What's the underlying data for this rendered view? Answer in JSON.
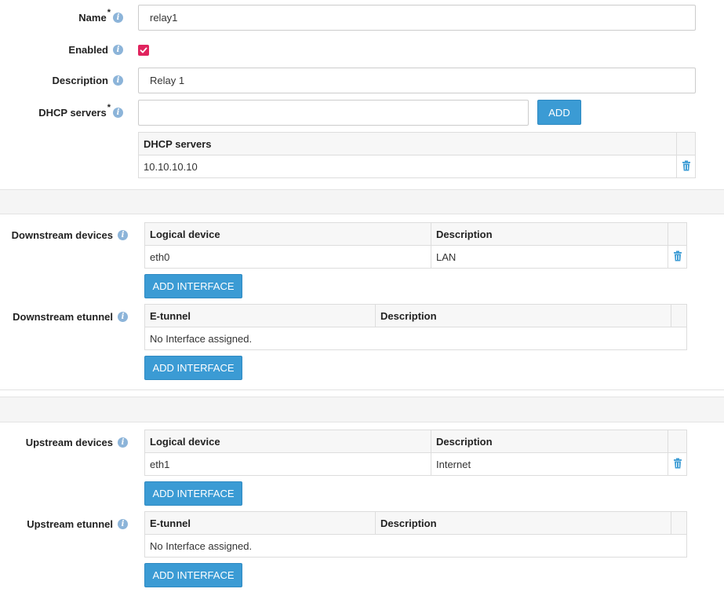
{
  "form": {
    "name": {
      "label": "Name",
      "required": "*",
      "value": "relay1"
    },
    "enabled": {
      "label": "Enabled",
      "checked": true
    },
    "description": {
      "label": "Description",
      "value": "Relay 1"
    },
    "dhcp_servers": {
      "label": "DHCP servers",
      "required": "*",
      "input_value": "",
      "add_label": "ADD",
      "table_header": "DHCP servers",
      "rows": [
        "10.10.10.10"
      ]
    }
  },
  "downstream": {
    "devices": {
      "label": "Downstream devices",
      "headers": [
        "Logical device",
        "Description"
      ],
      "rows": [
        {
          "device": "eth0",
          "description": "LAN"
        }
      ],
      "add_label": "ADD INTERFACE"
    },
    "etunnel": {
      "label": "Downstream etunnel",
      "headers": [
        "E-tunnel",
        "Description"
      ],
      "empty_text": "No Interface assigned.",
      "add_label": "ADD INTERFACE"
    }
  },
  "upstream": {
    "devices": {
      "label": "Upstream devices",
      "headers": [
        "Logical device",
        "Description"
      ],
      "rows": [
        {
          "device": "eth1",
          "description": "Internet"
        }
      ],
      "add_label": "ADD INTERFACE"
    },
    "etunnel": {
      "label": "Upstream etunnel",
      "headers": [
        "E-tunnel",
        "Description"
      ],
      "empty_text": "No Interface assigned.",
      "add_label": "ADD INTERFACE"
    }
  },
  "colors": {
    "accent": "#3b9bd4",
    "checkbox": "#e0245e",
    "info": "#8cb4d9",
    "trash": "#3b9bd4"
  },
  "icons": [
    "info-icon",
    "checkmark-icon",
    "trash-icon"
  ]
}
